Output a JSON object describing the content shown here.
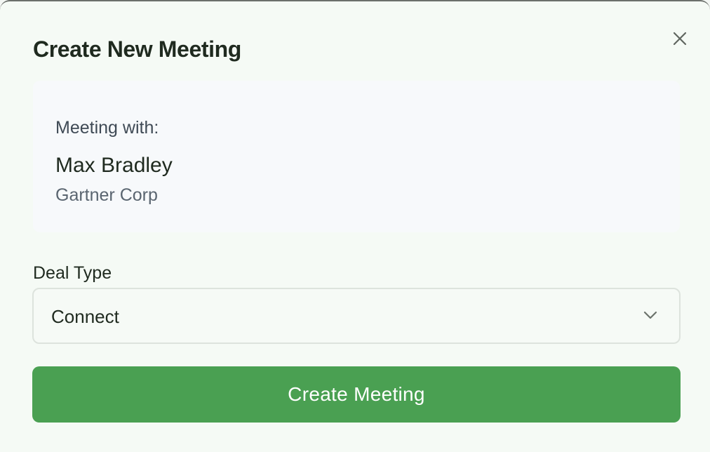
{
  "dialog": {
    "title": "Create New Meeting",
    "close_icon": "close-icon"
  },
  "meeting": {
    "label": "Meeting with:",
    "contact_name": "Max Bradley",
    "company": "Gartner Corp"
  },
  "deal_type": {
    "label": "Deal Type",
    "selected": "Connect",
    "icon": "chevron-down-icon"
  },
  "actions": {
    "create_label": "Create Meeting"
  },
  "colors": {
    "primary": "#4aa052",
    "background": "#f5faf5",
    "card": "#f7f9fb",
    "text": "#1f2a1f",
    "muted_text": "#5a6570",
    "border": "#dde3dd"
  }
}
